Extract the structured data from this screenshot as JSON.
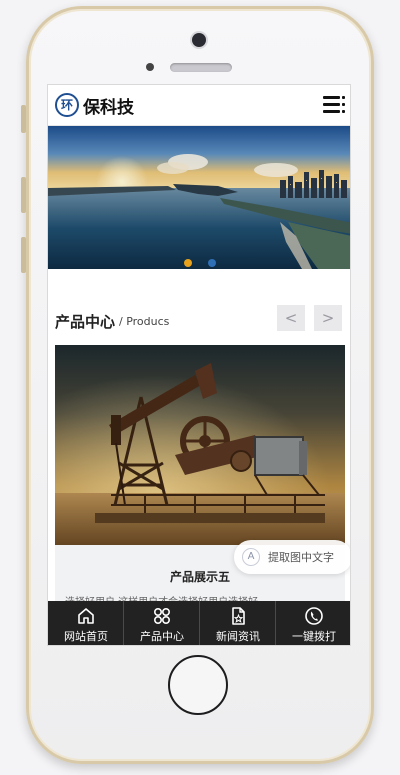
{
  "brand": {
    "logo_mark": "环",
    "name": "保科技",
    "color": "#1f4f92"
  },
  "header": {
    "menu_icon": "hamburger-menu-icon"
  },
  "banner": {
    "image": "harbor-city-sunset",
    "dots": [
      {
        "active": true,
        "color": "#e8a21b"
      },
      {
        "active": false,
        "color": "#2f6fb6"
      }
    ]
  },
  "products": {
    "title": "产品中心",
    "subtitle": "/ Producs",
    "prev_label": "<",
    "next_label": ">",
    "featured": {
      "image": "oil-pump-jack-sunset",
      "name": "产品展示五",
      "description": "选择好用户   这样用户才会选择好用户选择好"
    }
  },
  "ocr_button": {
    "label": "提取图中文字"
  },
  "tabbar": {
    "items": [
      {
        "label": "网站首页",
        "icon": "home-icon"
      },
      {
        "label": "产品中心",
        "icon": "grid-icon"
      },
      {
        "label": "新闻资讯",
        "icon": "news-icon"
      },
      {
        "label": "一键拨打",
        "icon": "phone-icon"
      }
    ]
  }
}
